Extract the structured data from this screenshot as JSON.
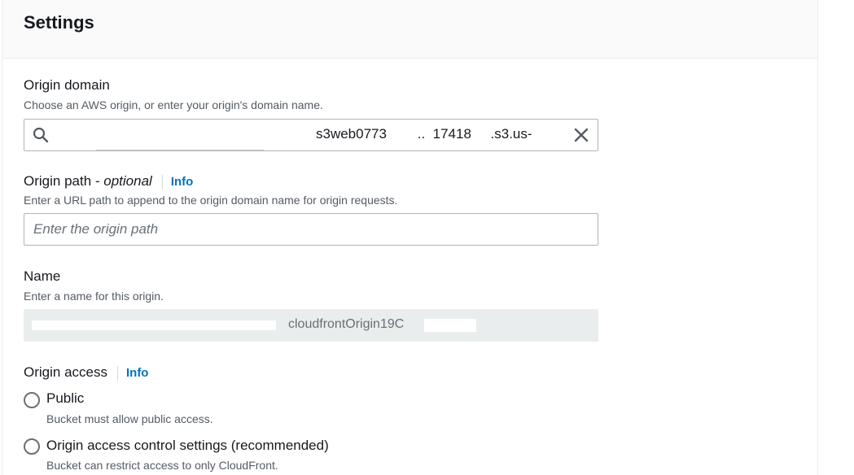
{
  "section": {
    "title": "Settings"
  },
  "origin_domain": {
    "label": "Origin domain",
    "description": "Choose an AWS origin, or enter your origin's domain name.",
    "value": "s3web0773        ..  17418     .s3.us-",
    "icons": {
      "search": "search-icon",
      "clear": "close-icon"
    }
  },
  "origin_path": {
    "label": "Origin path - ",
    "label_optional": "optional",
    "info": "Info",
    "description": "Enter a URL path to append to the origin domain name for origin requests.",
    "placeholder": "Enter the origin path"
  },
  "name": {
    "label": "Name",
    "description": "Enter a name for this origin.",
    "value": "cloudfrontOrigin19C"
  },
  "origin_access": {
    "label": "Origin access",
    "info": "Info",
    "options": [
      {
        "label": "Public",
        "description": "Bucket must allow public access.",
        "selected": false
      },
      {
        "label": "Origin access control settings (recommended)",
        "description": "Bucket can restrict access to only CloudFront.",
        "selected": false
      }
    ]
  },
  "colors": {
    "link": "#0073bb",
    "text": "#16191f",
    "muted": "#545b64",
    "border": "#aab7b8",
    "readonly_bg": "#eaeded"
  }
}
